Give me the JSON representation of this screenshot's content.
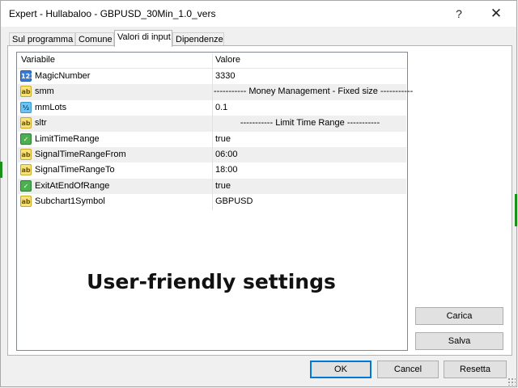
{
  "window": {
    "title": "Expert - Hullabaloo - GBPUSD_30Min_1.0_vers",
    "help_label": "?",
    "close_label": "✕"
  },
  "tabs": [
    {
      "label": "Sul programma"
    },
    {
      "label": "Comune"
    },
    {
      "label": "Valori di input"
    },
    {
      "label": "Dipendenze"
    }
  ],
  "grid": {
    "headers": {
      "variable": "Variabile",
      "value": "Valore"
    },
    "rows": [
      {
        "icon": "integer-icon",
        "icon_text": "123",
        "name": "MagicNumber",
        "value": "3330"
      },
      {
        "icon": "string-icon",
        "icon_text": "ab",
        "name": "smm",
        "value": "----------- Money Management - Fixed size -----------"
      },
      {
        "icon": "double-icon",
        "icon_text": "½",
        "name": "mmLots",
        "value": "0.1"
      },
      {
        "icon": "string-icon",
        "icon_text": "ab",
        "name": "sltr",
        "value": "----------- Limit Time Range -----------"
      },
      {
        "icon": "boolean-icon",
        "icon_text": "✓",
        "name": "LimitTimeRange",
        "value": "true"
      },
      {
        "icon": "string-icon",
        "icon_text": "ab",
        "name": "SignalTimeRangeFrom",
        "value": "06:00"
      },
      {
        "icon": "string-icon",
        "icon_text": "ab",
        "name": "SignalTimeRangeTo",
        "value": "18:00"
      },
      {
        "icon": "boolean-icon",
        "icon_text": "✓",
        "name": "ExitAtEndOfRange",
        "value": "true"
      },
      {
        "icon": "string-icon",
        "icon_text": "ab",
        "name": "Subchart1Symbol",
        "value": "GBPUSD"
      }
    ]
  },
  "banner": "User-friendly settings",
  "buttons": {
    "load": "Carica",
    "save": "Salva",
    "ok": "OK",
    "cancel": "Cancel",
    "reset": "Resetta"
  },
  "colors": {
    "accent": "#0078d7",
    "row_alt": "#efefef"
  }
}
